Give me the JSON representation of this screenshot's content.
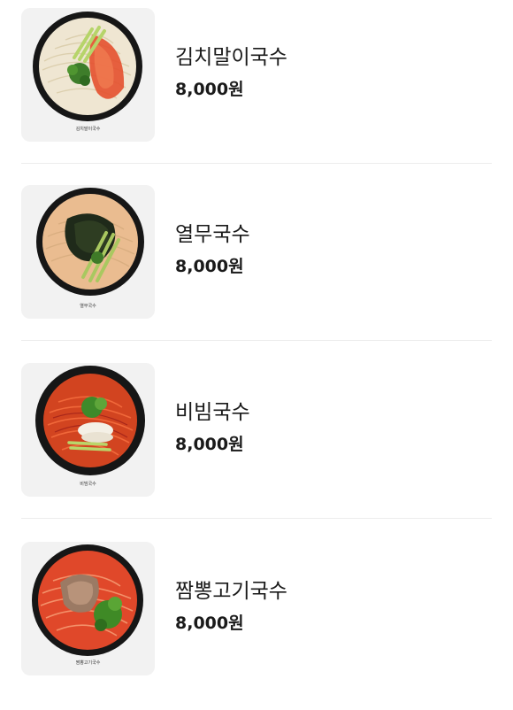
{
  "menu": {
    "items": [
      {
        "name": "김치말이국수",
        "price": "8,000원",
        "image_caption": "김치말이국수",
        "image": "kimchi-marinated-noodle-bowl"
      },
      {
        "name": "열무국수",
        "price": "8,000원",
        "image_caption": "열무국수",
        "image": "young-radish-noodle-bowl"
      },
      {
        "name": "비빔국수",
        "price": "8,000원",
        "image_caption": "비빔국수",
        "image": "spicy-mixed-noodle-bowl"
      },
      {
        "name": "짬뽕고기국수",
        "price": "8,000원",
        "image_caption": "짬뽕고기국수",
        "image": "spicy-meat-noodle-bowl"
      }
    ]
  },
  "colors": {
    "background": "#ffffff",
    "thumb_background": "#f2f2f2",
    "divider": "#ececec",
    "text": "#1a1a1a"
  }
}
